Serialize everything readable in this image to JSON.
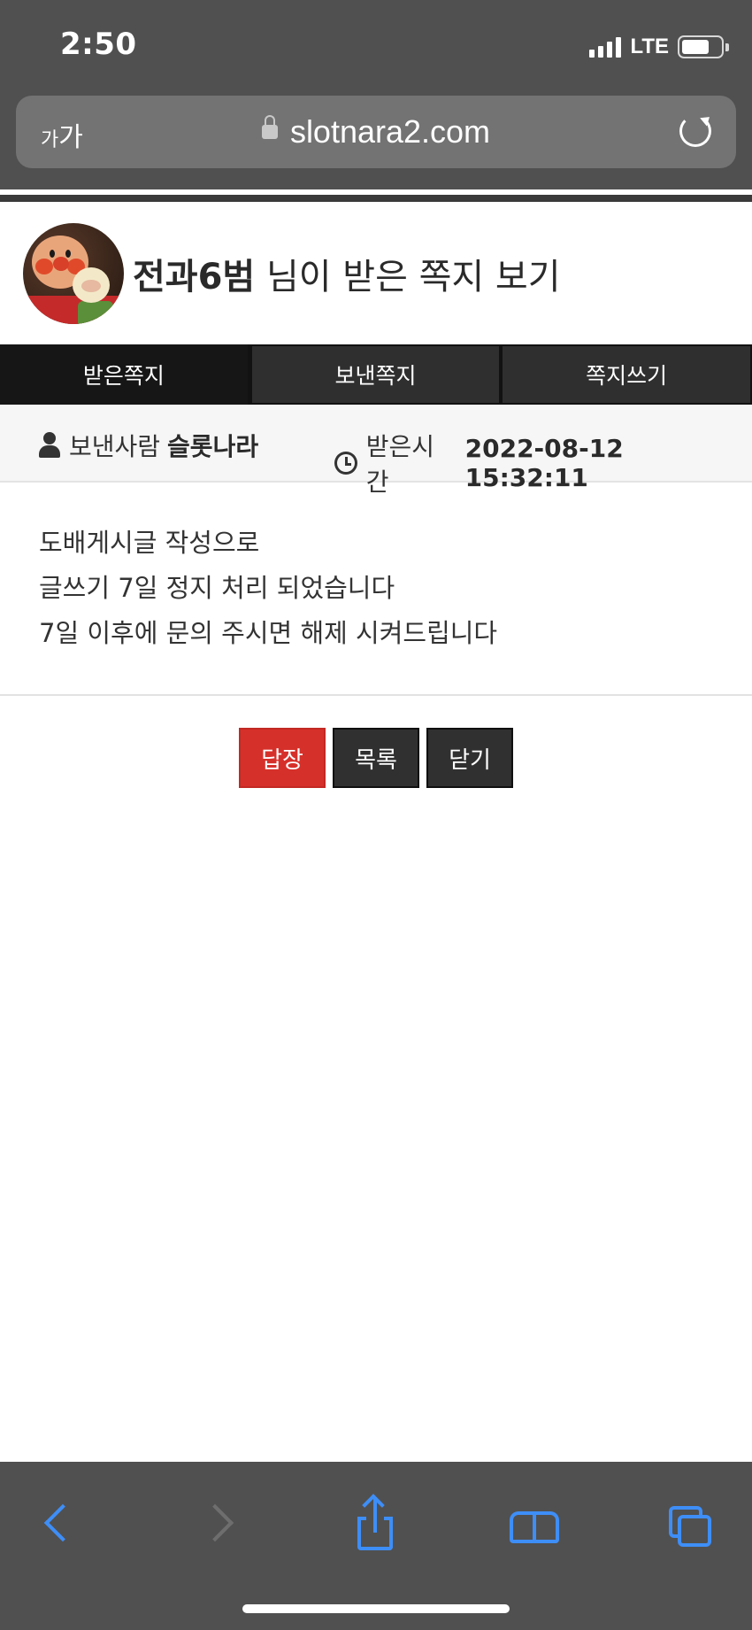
{
  "status_bar": {
    "time": "2:50",
    "network": "LTE",
    "battery_level": 0.7
  },
  "browser": {
    "text_size_label_small": "가",
    "text_size_label_large": "가",
    "url": "slotnara2.com"
  },
  "header": {
    "title_nickname": "전과6범",
    "title_suffix": " 님이 받은 쪽지 보기"
  },
  "tabs": [
    {
      "label": "받은쪽지",
      "active": true
    },
    {
      "label": "보낸쪽지",
      "active": false
    },
    {
      "label": "쪽지쓰기",
      "active": false
    }
  ],
  "info": {
    "sender_label": "보낸사람",
    "sender_name": "슬롯나라",
    "received_label": "받은시간",
    "received_time": "2022-08-12 15:32:11"
  },
  "message": {
    "lines": [
      "도배게시글 작성으로",
      "글쓰기 7일 정지 처리 되었습니다",
      "7일 이후에 문의 주시면 해제 시켜드립니다"
    ]
  },
  "buttons": {
    "reply": "답장",
    "list": "목록",
    "close": "닫기"
  },
  "colors": {
    "reply_button": "#d6302a",
    "ios_blue": "#3e8ef7",
    "chrome": "#505050"
  }
}
